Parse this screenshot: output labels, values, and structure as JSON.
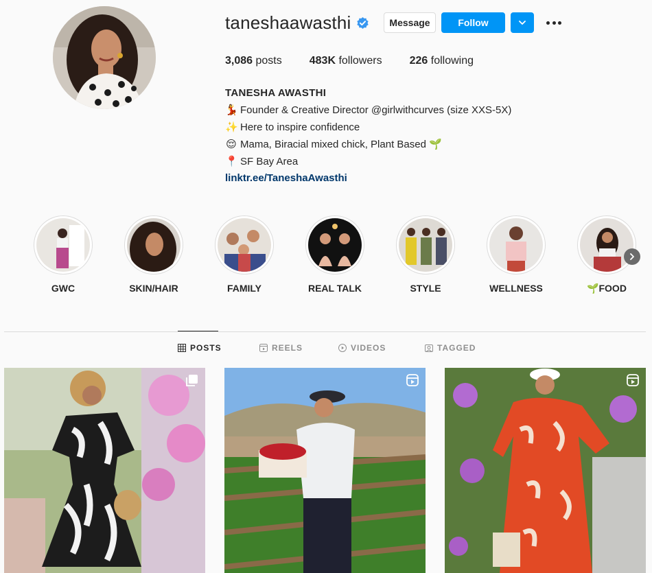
{
  "profile": {
    "username": "taneshaawasthi",
    "verified": true,
    "buttons": {
      "message": "Message",
      "follow": "Follow"
    },
    "stats": [
      {
        "count": "3,086",
        "label": "posts"
      },
      {
        "count": "483K",
        "label": "followers"
      },
      {
        "count": "226",
        "label": "following"
      }
    ],
    "full_name": "TANESHA AWASTHI",
    "bio_lines": [
      {
        "emoji": "💃",
        "text": "Founder & Creative Director @girlwithcurves (size XXS-5X)"
      },
      {
        "emoji": "✨",
        "text": "Here to inspire confidence"
      },
      {
        "emoji": "😌",
        "text": "Mama, Biracial mixed chick, Plant Based 🌱"
      },
      {
        "emoji": "📍",
        "text": "SF Bay Area"
      }
    ],
    "link": "linktr.ee/TaneshaAwasthi"
  },
  "highlights": [
    {
      "label": "GWC"
    },
    {
      "label": "SKIN/HAIR"
    },
    {
      "label": "FAMILY"
    },
    {
      "label": "REAL TALK"
    },
    {
      "label": "STYLE"
    },
    {
      "label": "WELLNESS"
    },
    {
      "label": "🌱FOOD"
    }
  ],
  "tabs": [
    {
      "label": "POSTS",
      "icon": "grid-icon",
      "active": true
    },
    {
      "label": "REELS",
      "icon": "reels-icon",
      "active": false
    },
    {
      "label": "VIDEOS",
      "icon": "play-icon",
      "active": false
    },
    {
      "label": "TAGGED",
      "icon": "tag-icon",
      "active": false
    }
  ],
  "posts": [
    {
      "type": "carousel",
      "icon": "carousel-icon"
    },
    {
      "type": "reel",
      "icon": "reel-icon"
    },
    {
      "type": "reel",
      "icon": "reel-icon"
    }
  ],
  "colors": {
    "accent": "#0095f6",
    "link": "#00376b",
    "background": "#fafafa",
    "text": "#262626",
    "muted": "#8e8e8e"
  }
}
